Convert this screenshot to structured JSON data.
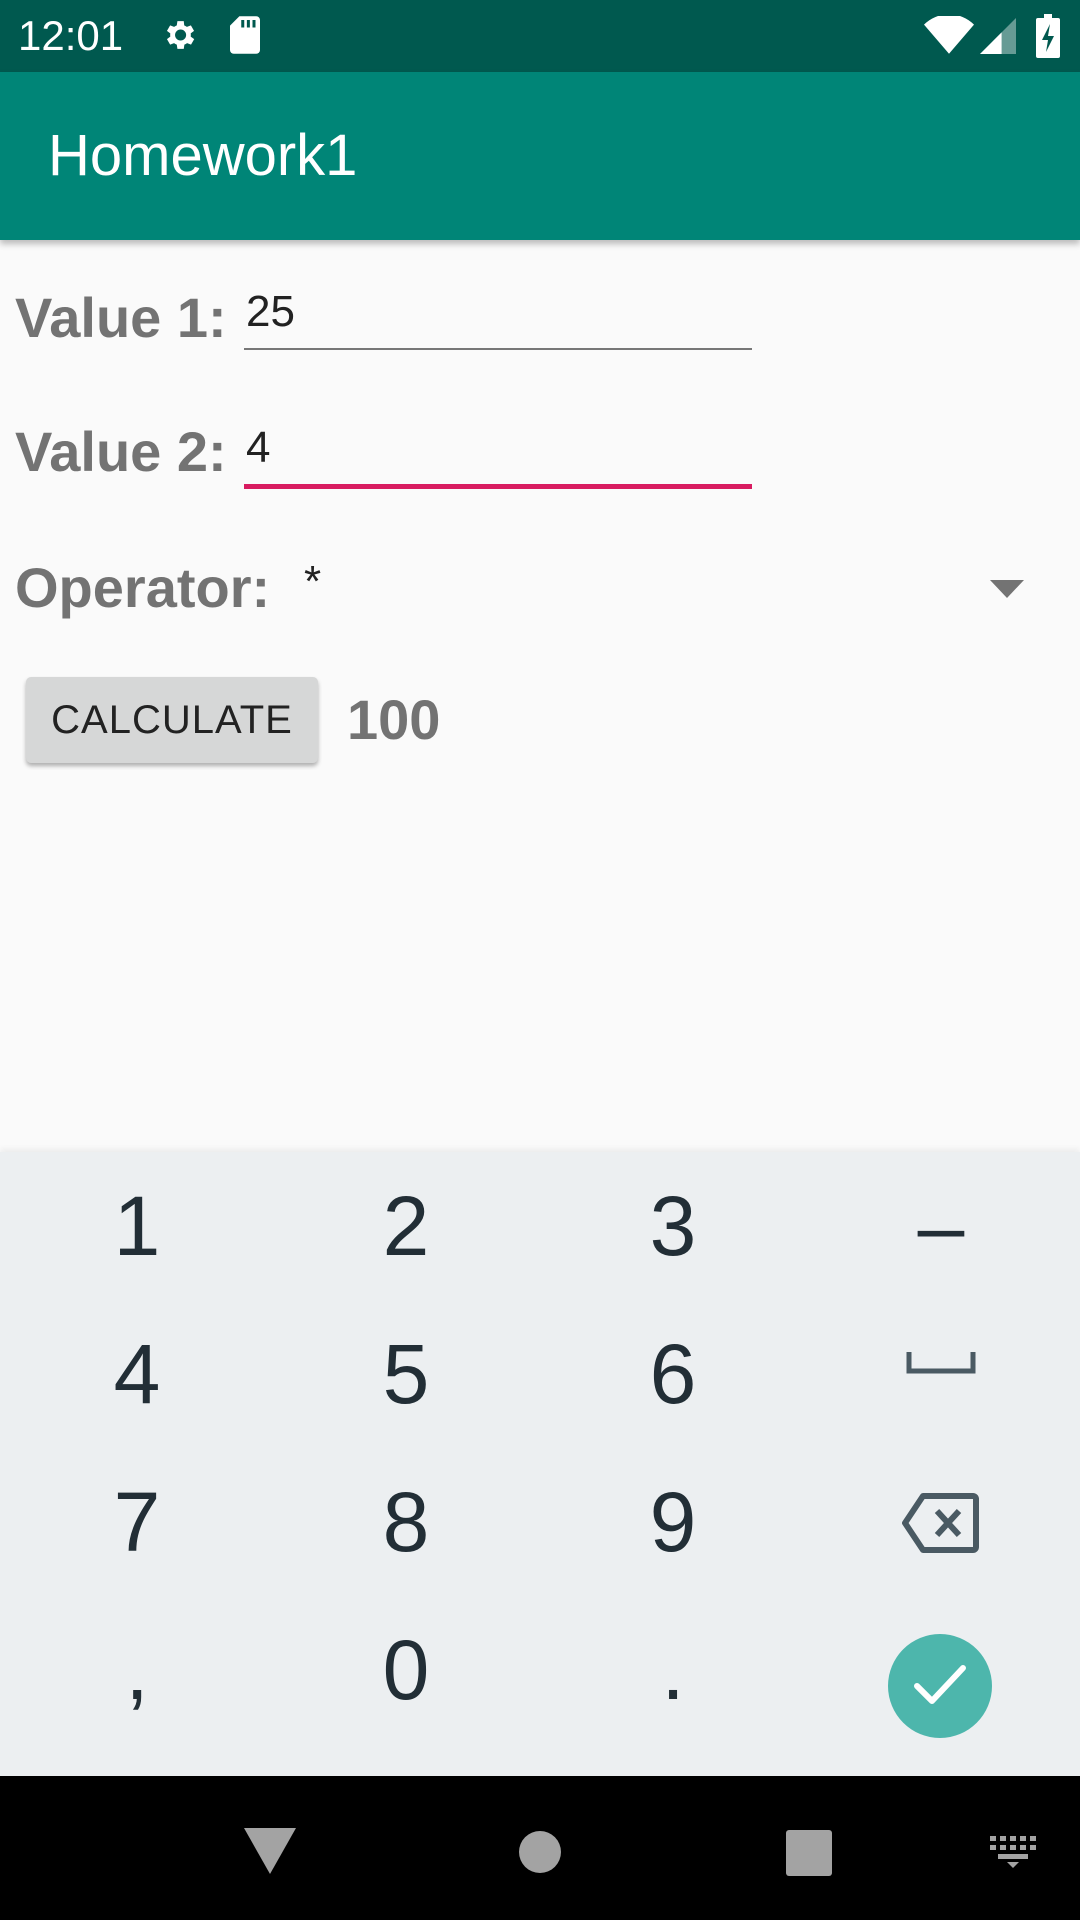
{
  "status_bar": {
    "time": "12:01",
    "icons": [
      "gear-icon",
      "sd-card-icon",
      "wifi-icon",
      "cell-signal-icon",
      "battery-charging-icon"
    ]
  },
  "app_bar": {
    "title": "Homework1"
  },
  "form": {
    "value1": {
      "label": "Value 1:",
      "value": "25"
    },
    "value2": {
      "label": "Value 2:",
      "value": "4"
    },
    "operator": {
      "label": "Operator:",
      "selected": "*"
    },
    "calculate_label": "CALCULATE",
    "result": "100"
  },
  "keyboard": {
    "rows": [
      [
        "1",
        "2",
        "3",
        "–"
      ],
      [
        "4",
        "5",
        "6",
        "space"
      ],
      [
        "7",
        "8",
        "9",
        "backspace"
      ],
      [
        ",",
        "0",
        ".",
        "done"
      ]
    ]
  },
  "nav_bar": {
    "icons": [
      "back-icon",
      "home-icon",
      "recents-icon",
      "keyboard-switch-icon"
    ]
  },
  "colors": {
    "status_bar": "#00594f",
    "app_bar": "#008577",
    "accent": "#d81b60",
    "done_key": "#4db6ac",
    "keyboard_bg": "#eceff1"
  }
}
